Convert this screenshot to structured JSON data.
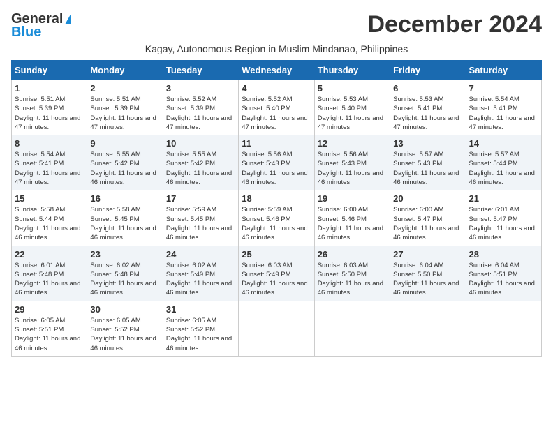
{
  "logo": {
    "line1": "General",
    "line2": "Blue"
  },
  "title": "December 2024",
  "subtitle": "Kagay, Autonomous Region in Muslim Mindanao, Philippines",
  "weekdays": [
    "Sunday",
    "Monday",
    "Tuesday",
    "Wednesday",
    "Thursday",
    "Friday",
    "Saturday"
  ],
  "weeks": [
    [
      {
        "day": "1",
        "sunrise": "5:51 AM",
        "sunset": "5:39 PM",
        "daylight": "11 hours and 47 minutes."
      },
      {
        "day": "2",
        "sunrise": "5:51 AM",
        "sunset": "5:39 PM",
        "daylight": "11 hours and 47 minutes."
      },
      {
        "day": "3",
        "sunrise": "5:52 AM",
        "sunset": "5:39 PM",
        "daylight": "11 hours and 47 minutes."
      },
      {
        "day": "4",
        "sunrise": "5:52 AM",
        "sunset": "5:40 PM",
        "daylight": "11 hours and 47 minutes."
      },
      {
        "day": "5",
        "sunrise": "5:53 AM",
        "sunset": "5:40 PM",
        "daylight": "11 hours and 47 minutes."
      },
      {
        "day": "6",
        "sunrise": "5:53 AM",
        "sunset": "5:41 PM",
        "daylight": "11 hours and 47 minutes."
      },
      {
        "day": "7",
        "sunrise": "5:54 AM",
        "sunset": "5:41 PM",
        "daylight": "11 hours and 47 minutes."
      }
    ],
    [
      {
        "day": "8",
        "sunrise": "5:54 AM",
        "sunset": "5:41 PM",
        "daylight": "11 hours and 47 minutes."
      },
      {
        "day": "9",
        "sunrise": "5:55 AM",
        "sunset": "5:42 PM",
        "daylight": "11 hours and 46 minutes."
      },
      {
        "day": "10",
        "sunrise": "5:55 AM",
        "sunset": "5:42 PM",
        "daylight": "11 hours and 46 minutes."
      },
      {
        "day": "11",
        "sunrise": "5:56 AM",
        "sunset": "5:43 PM",
        "daylight": "11 hours and 46 minutes."
      },
      {
        "day": "12",
        "sunrise": "5:56 AM",
        "sunset": "5:43 PM",
        "daylight": "11 hours and 46 minutes."
      },
      {
        "day": "13",
        "sunrise": "5:57 AM",
        "sunset": "5:43 PM",
        "daylight": "11 hours and 46 minutes."
      },
      {
        "day": "14",
        "sunrise": "5:57 AM",
        "sunset": "5:44 PM",
        "daylight": "11 hours and 46 minutes."
      }
    ],
    [
      {
        "day": "15",
        "sunrise": "5:58 AM",
        "sunset": "5:44 PM",
        "daylight": "11 hours and 46 minutes."
      },
      {
        "day": "16",
        "sunrise": "5:58 AM",
        "sunset": "5:45 PM",
        "daylight": "11 hours and 46 minutes."
      },
      {
        "day": "17",
        "sunrise": "5:59 AM",
        "sunset": "5:45 PM",
        "daylight": "11 hours and 46 minutes."
      },
      {
        "day": "18",
        "sunrise": "5:59 AM",
        "sunset": "5:46 PM",
        "daylight": "11 hours and 46 minutes."
      },
      {
        "day": "19",
        "sunrise": "6:00 AM",
        "sunset": "5:46 PM",
        "daylight": "11 hours and 46 minutes."
      },
      {
        "day": "20",
        "sunrise": "6:00 AM",
        "sunset": "5:47 PM",
        "daylight": "11 hours and 46 minutes."
      },
      {
        "day": "21",
        "sunrise": "6:01 AM",
        "sunset": "5:47 PM",
        "daylight": "11 hours and 46 minutes."
      }
    ],
    [
      {
        "day": "22",
        "sunrise": "6:01 AM",
        "sunset": "5:48 PM",
        "daylight": "11 hours and 46 minutes."
      },
      {
        "day": "23",
        "sunrise": "6:02 AM",
        "sunset": "5:48 PM",
        "daylight": "11 hours and 46 minutes."
      },
      {
        "day": "24",
        "sunrise": "6:02 AM",
        "sunset": "5:49 PM",
        "daylight": "11 hours and 46 minutes."
      },
      {
        "day": "25",
        "sunrise": "6:03 AM",
        "sunset": "5:49 PM",
        "daylight": "11 hours and 46 minutes."
      },
      {
        "day": "26",
        "sunrise": "6:03 AM",
        "sunset": "5:50 PM",
        "daylight": "11 hours and 46 minutes."
      },
      {
        "day": "27",
        "sunrise": "6:04 AM",
        "sunset": "5:50 PM",
        "daylight": "11 hours and 46 minutes."
      },
      {
        "day": "28",
        "sunrise": "6:04 AM",
        "sunset": "5:51 PM",
        "daylight": "11 hours and 46 minutes."
      }
    ],
    [
      {
        "day": "29",
        "sunrise": "6:05 AM",
        "sunset": "5:51 PM",
        "daylight": "11 hours and 46 minutes."
      },
      {
        "day": "30",
        "sunrise": "6:05 AM",
        "sunset": "5:52 PM",
        "daylight": "11 hours and 46 minutes."
      },
      {
        "day": "31",
        "sunrise": "6:05 AM",
        "sunset": "5:52 PM",
        "daylight": "11 hours and 46 minutes."
      },
      null,
      null,
      null,
      null
    ]
  ],
  "labels": {
    "sunrise": "Sunrise:",
    "sunset": "Sunset:",
    "daylight": "Daylight:"
  }
}
